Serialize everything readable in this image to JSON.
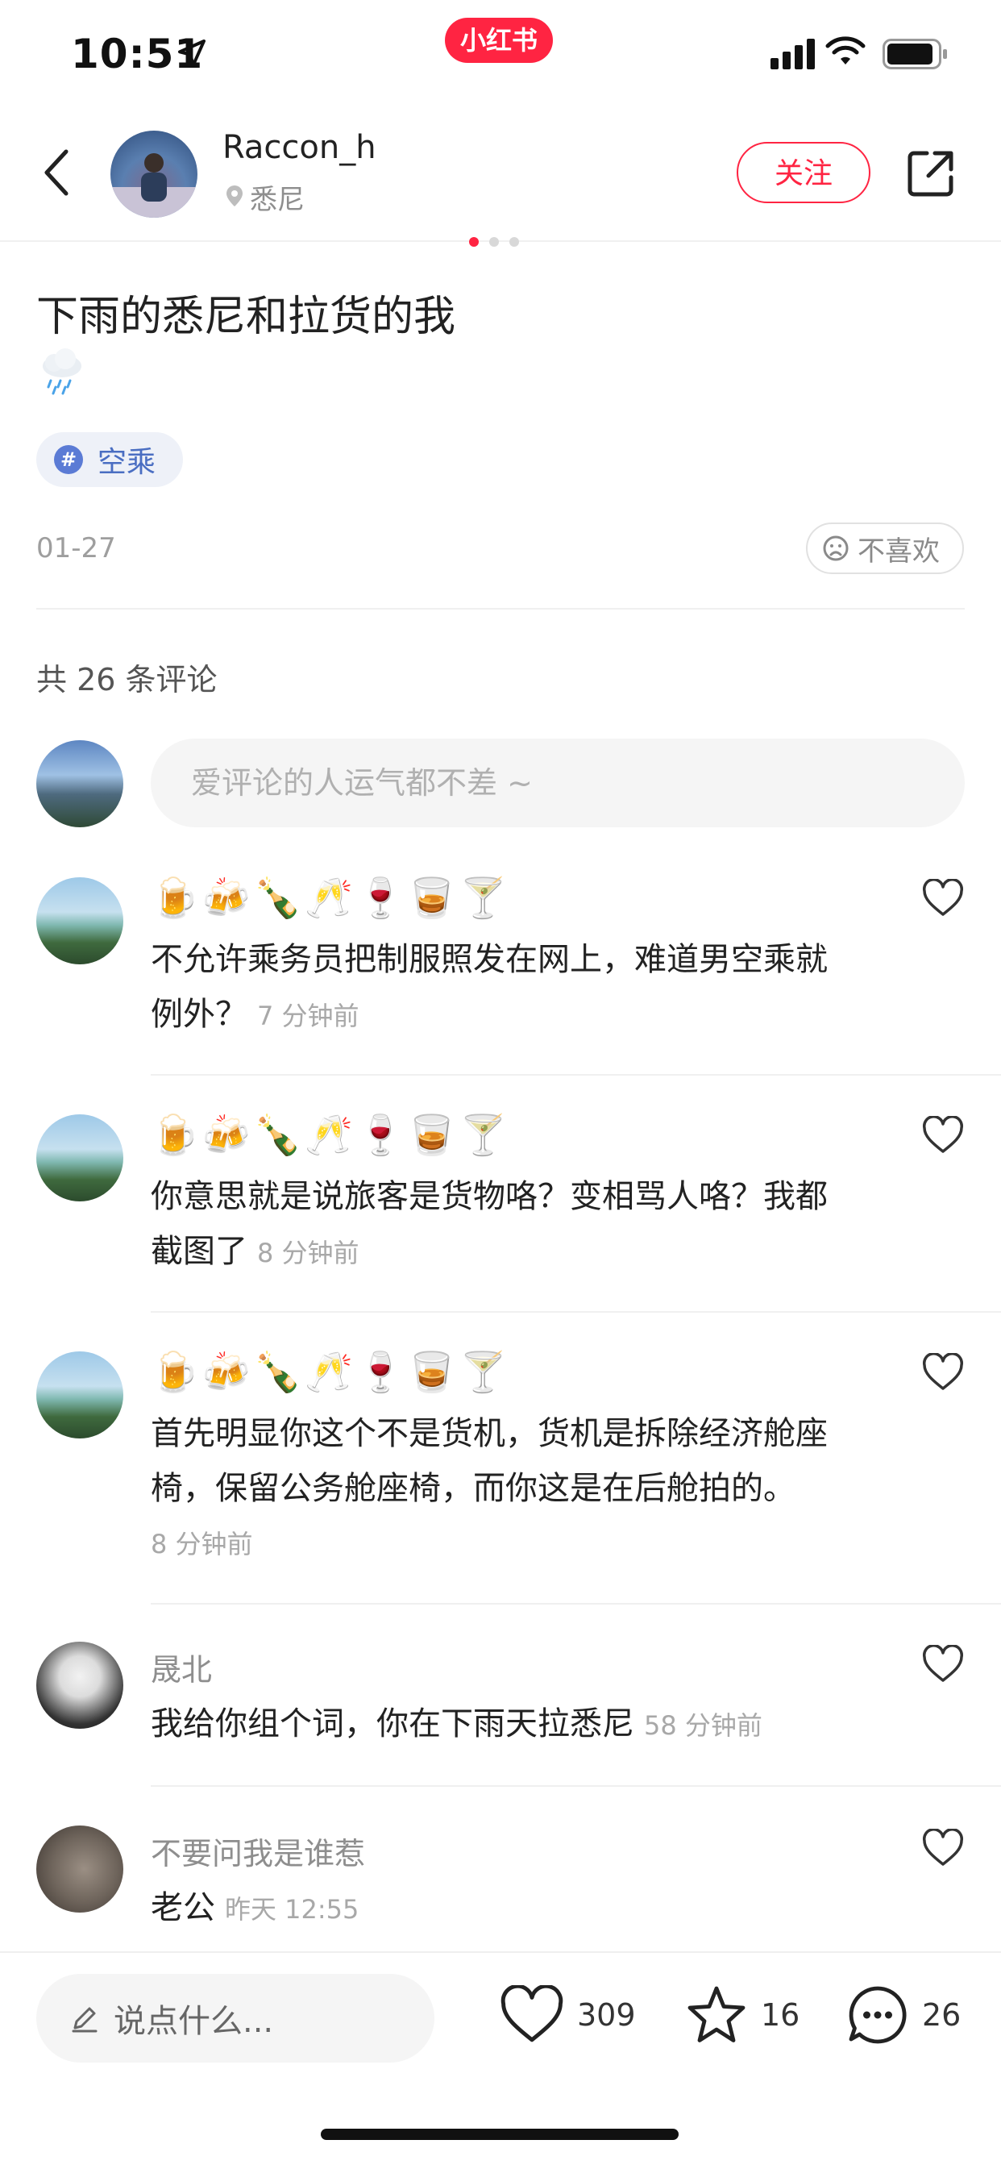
{
  "status_bar": {
    "time": "10:51",
    "app_badge": "小红书"
  },
  "header": {
    "username": "Raccon_h",
    "location": "悉尼",
    "follow_label": "关注"
  },
  "note": {
    "title": "下雨的悉尼和拉货的我",
    "tag": "空乘",
    "date": "01-27",
    "dislike_label": "不喜欢"
  },
  "comments_section": {
    "count_label": "共 26 条评论",
    "input_placeholder": "爱评论的人运气都不差 ~"
  },
  "comments": [
    {
      "name": "🍺🍻🍾🥂🍷🥃🍸",
      "text_line1": "不允许乘务员把制服照发在网上，难道男空乘就",
      "text_line2": "例外？",
      "time": "7 分钟前"
    },
    {
      "name": "🍺🍻🍾🥂🍷🥃🍸",
      "text_line1": "你意思就是说旅客是货物咯？变相骂人咯？我都",
      "text_line2": "截图了",
      "time": "8 分钟前"
    },
    {
      "name": "🍺🍻🍾🥂🍷🥃🍸",
      "text_line1": "首先明显你这个不是货机，货机是拆除经济舱座",
      "text_line2": "椅，保留公务舱座椅，而你这是在后舱拍的。",
      "time": "8 分钟前"
    },
    {
      "name": "晟北",
      "text": "我给你组个词，你在下雨天拉悉尼",
      "time": "58 分钟前"
    },
    {
      "name": "不要问我是谁惹",
      "text": "老公",
      "time": "昨天 12:55"
    }
  ],
  "bottom_bar": {
    "say_placeholder": "说点什么...",
    "likes": "309",
    "collects": "16",
    "comments": "26"
  },
  "colors": {
    "brand": "#ff2442",
    "tag_blue": "#4a6ec2",
    "muted": "#9e9e9e"
  },
  "icons": [
    "location-arrow-icon",
    "signal-icon",
    "wifi-icon",
    "battery-icon",
    "back-icon",
    "location-pin-icon",
    "share-icon",
    "rain-cloud-icon",
    "hashtag-icon",
    "sad-face-icon",
    "heart-icon",
    "pencil-icon",
    "star-icon",
    "comment-icon"
  ]
}
